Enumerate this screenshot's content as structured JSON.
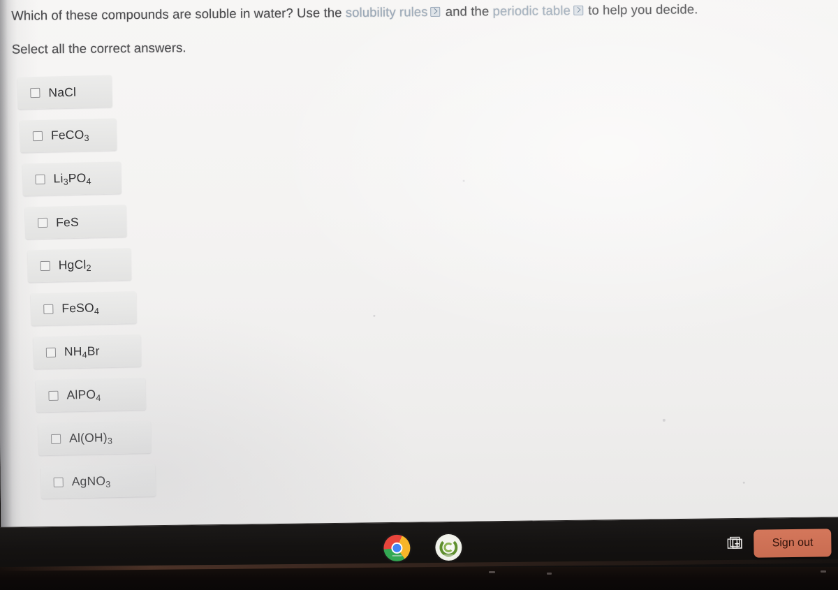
{
  "question": {
    "prefix": "Which of these compounds are soluble in water? Use the ",
    "link1": "solubility rules",
    "middle": " and the ",
    "link2": "periodic table",
    "suffix": " to help you decide.",
    "instruction": "Select all the correct answers."
  },
  "options": [
    {
      "id": "nacl",
      "formula": "NaCl",
      "html": "NaCl"
    },
    {
      "id": "feco3",
      "formula": "FeCO3",
      "html": "FeCO<sub>3</sub>"
    },
    {
      "id": "li3po4",
      "formula": "Li3PO4",
      "html": "Li<sub>3</sub>PO<sub>4</sub>"
    },
    {
      "id": "fes",
      "formula": "FeS",
      "html": "FeS"
    },
    {
      "id": "hgcl2",
      "formula": "HgCl2",
      "html": "HgCl<sub>2</sub>"
    },
    {
      "id": "feso4",
      "formula": "FeSO4",
      "html": "FeSO<sub>4</sub>"
    },
    {
      "id": "nh4br",
      "formula": "NH4Br",
      "html": "NH<sub>4</sub>Br"
    },
    {
      "id": "alpo4",
      "formula": "AlPO4",
      "html": "AlPO<sub>4</sub>"
    },
    {
      "id": "aloh3",
      "formula": "Al(OH)3",
      "html": "Al(OH)<sub>3</sub>"
    },
    {
      "id": "agno3",
      "formula": "AgNO3",
      "html": "AgNO<sub>3</sub>"
    }
  ],
  "shelf": {
    "apps": [
      {
        "name": "chrome-app-icon",
        "label": "Chrome"
      },
      {
        "name": "green-circle-app-icon",
        "label": "App"
      }
    ],
    "capture_icon": "screen-capture-icon",
    "sign_out_label": "Sign out",
    "mic_icon": "microphone-icon"
  },
  "colors": {
    "page_background": "#f4f3f2",
    "option_background": "#e8e8e7",
    "link": "#9aa9b8",
    "text": "#4a4a4c",
    "option_text": "#2f2f31",
    "shelf": "#141211",
    "sign_out_button": "#cc7055"
  }
}
